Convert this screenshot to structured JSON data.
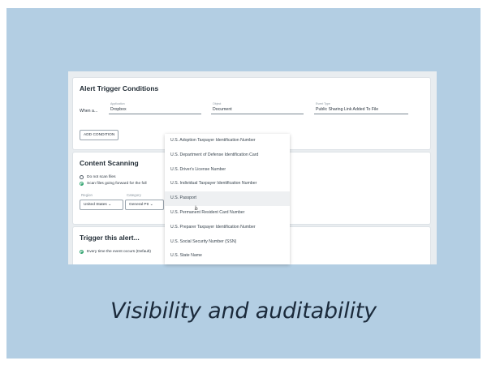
{
  "caption": "Visibility and auditability",
  "alert_trigger": {
    "title": "Alert Trigger Conditions",
    "when_label": "When a...",
    "application_label": "Application",
    "application_value": "Dropbox",
    "object_label": "Object",
    "object_value": "Document",
    "event_type_label": "Event Type",
    "event_type_value": "Public Sharing Link Added To File",
    "add_condition": "ADD CONDITION"
  },
  "content_scanning": {
    "title": "Content Scanning",
    "option_1": "Do not scan files",
    "option_2": "Scan files going forward for the foll",
    "region_label": "Region",
    "region_value": "United States",
    "category_label": "Category",
    "category_value": "General PII"
  },
  "trigger": {
    "title": "Trigger this alert...",
    "option_1": "Every time the event occurs (Default)"
  },
  "dropdown": {
    "items": [
      "U.S. Adoption Taxpayer Identification Number",
      "U.S. Department of Defense Identification Card",
      "U.S. Driver's License Number",
      "U.S. Individual Taxpayer Identification Number",
      "U.S. Passport",
      "U.S. Permanent Resident Card Number",
      "U.S. Preparer Taxpayer Identification Number",
      "U.S. Social Security Number (SSN)",
      "U.S. State Name"
    ],
    "highlighted_index": 4
  },
  "colors": {
    "background": "#b3cee3",
    "accent_radio": "#2fa36e",
    "caption": "#1b2a3b"
  }
}
